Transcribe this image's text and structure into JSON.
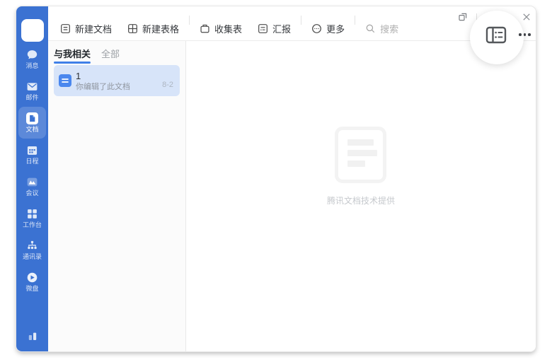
{
  "titlebar": {
    "controls": [
      {
        "name": "detach-window"
      },
      {
        "name": "maximize"
      },
      {
        "name": "close"
      }
    ]
  },
  "toolbar": {
    "new_doc": "新建文档",
    "new_sheet": "新建表格",
    "collect_form": "收集表",
    "report": "汇报",
    "more": "更多",
    "search": "搜索"
  },
  "topbar_right": {
    "layout_icon": "layout-list-view",
    "more_icon": "more-horizontal"
  },
  "sidebar": {
    "items": [
      {
        "label": "消息",
        "icon": "chat-bubble"
      },
      {
        "label": "邮件",
        "icon": "mail-envelope"
      },
      {
        "label": "文档",
        "icon": "tencent-docs",
        "active": true
      },
      {
        "label": "日程",
        "icon": "calendar"
      },
      {
        "label": "会议",
        "icon": "meeting"
      },
      {
        "label": "工作台",
        "icon": "workbench-grid"
      },
      {
        "label": "通讯录",
        "icon": "contacts-orgchart"
      },
      {
        "label": "微盘",
        "icon": "wedrive"
      }
    ],
    "bottom_icon": "bar-chart"
  },
  "list_panel": {
    "tabs": [
      {
        "label": "与我相关",
        "active": true
      },
      {
        "label": "全部",
        "active": false
      }
    ],
    "documents": [
      {
        "title": "1",
        "subtitle": "你编辑了此文档",
        "date": "8-2",
        "icon": "doc-file"
      }
    ]
  },
  "main": {
    "empty_caption": "腾讯文档技术提供",
    "empty_icon": "document-placeholder"
  },
  "colors": {
    "sidebar_blue": "#3B72D2",
    "accent_blue": "#4080E8",
    "selected_item_bg": "#D7E4F9",
    "doc_icon_blue": "#4A87EE"
  }
}
